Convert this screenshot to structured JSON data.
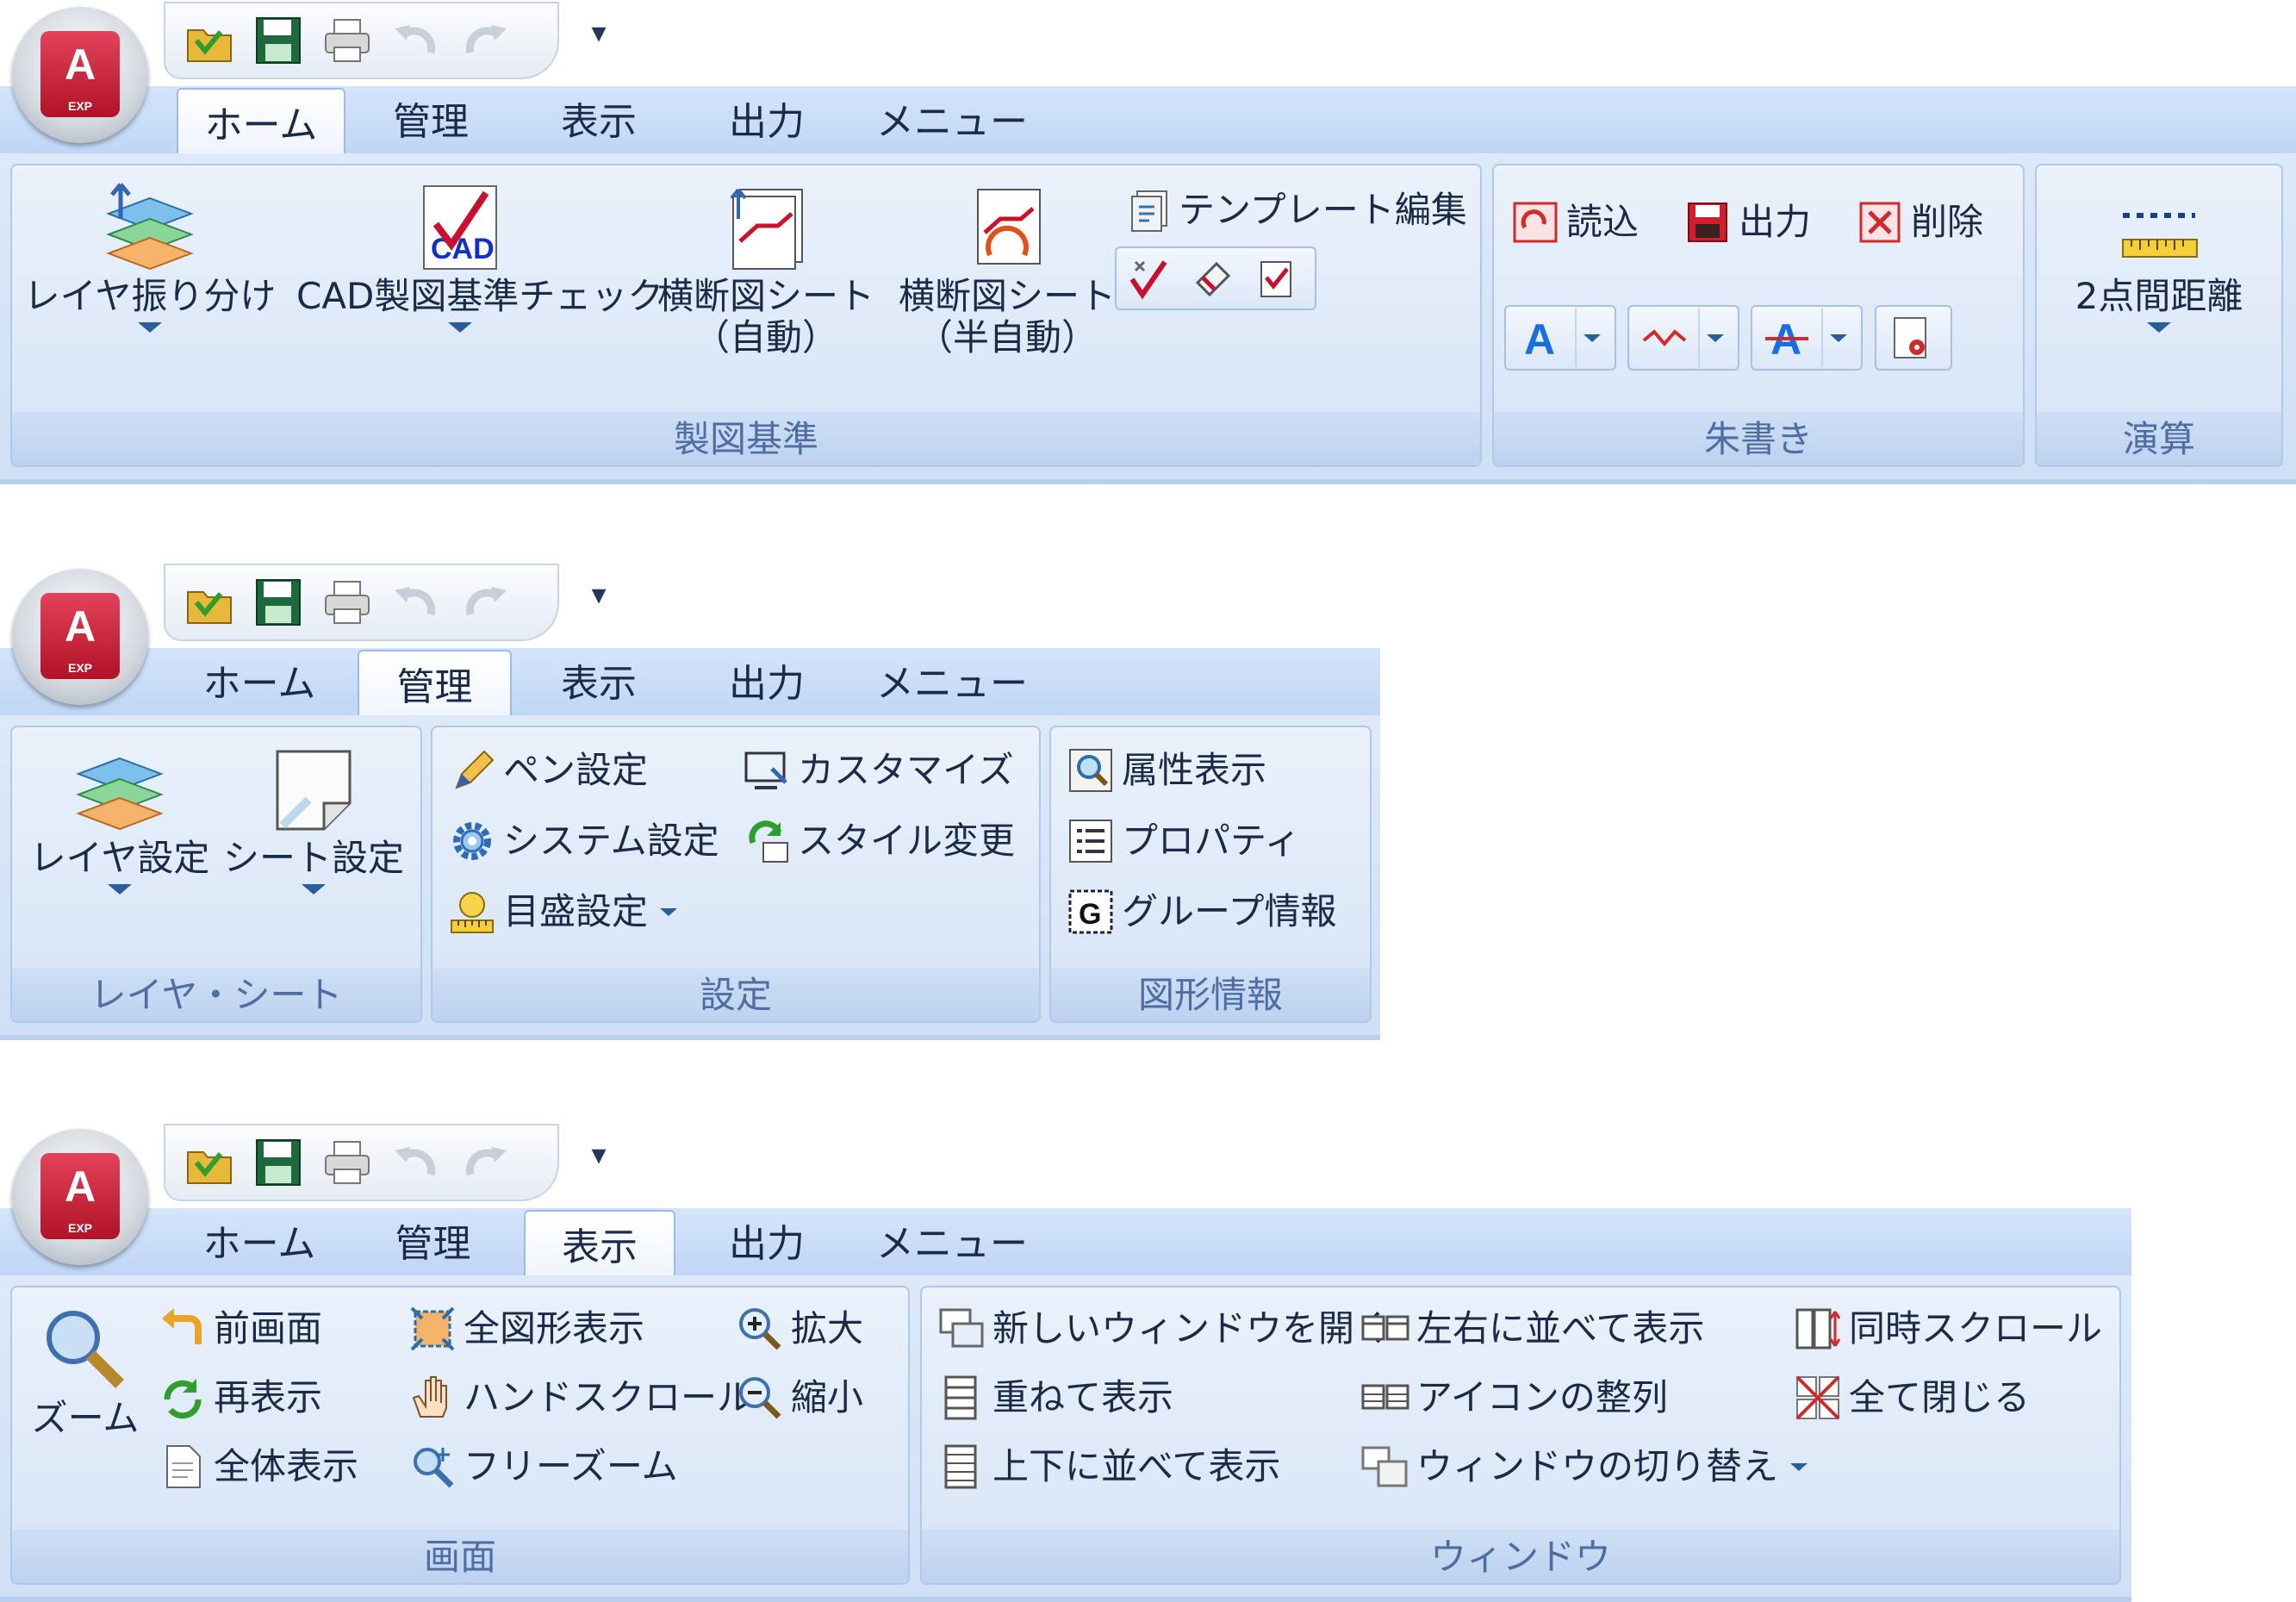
{
  "app_button": {
    "letter": "A",
    "sub": "EXP"
  },
  "qat": {
    "more_symbol": "▾"
  },
  "tabs": {
    "home": "ホーム",
    "manage": "管理",
    "view": "表示",
    "output": "出力",
    "menu": "メニュー"
  },
  "panel1": {
    "drafting_group": {
      "label": "製図基準",
      "layer_sort": "レイヤ振り分け",
      "cad_check": "CAD製図基準チェック",
      "cross_auto_1": "横断図シート",
      "cross_auto_2": "（自動）",
      "cross_semi_1": "横断図シート",
      "cross_semi_2": "（半自動）",
      "template_edit": "テンプレート編集"
    },
    "redline_group": {
      "label": "朱書き",
      "load": "読込",
      "output": "出力",
      "delete": "削除"
    },
    "calc_group": {
      "label": "演算",
      "distance": "2点間距離"
    }
  },
  "panel2": {
    "layer_group": {
      "label": "レイヤ・シート",
      "layer_settings": "レイヤ設定",
      "sheet_settings": "シート設定"
    },
    "settings_group": {
      "label": "設定",
      "pen": "ペン設定",
      "customize": "カスタマイズ",
      "system": "システム設定",
      "style": "スタイル変更",
      "scale": "目盛設定"
    },
    "shape_group": {
      "label": "図形情報",
      "attr": "属性表示",
      "prop": "プロパティ",
      "group": "グループ情報"
    }
  },
  "panel3": {
    "screen_group": {
      "label": "画面",
      "zoom": "ズーム",
      "prev": "前画面",
      "redraw": "再表示",
      "whole": "全体表示",
      "all_shapes": "全図形表示",
      "hand_scroll": "ハンドスクロール",
      "free_zoom": "フリーズーム",
      "zoom_in": "拡大",
      "zoom_out": "縮小"
    },
    "window_group": {
      "label": "ウィンドウ",
      "new_window": "新しいウィンドウを開く",
      "cascade": "重ねて表示",
      "tile_vertical": "上下に並べて表示",
      "tile_horizontal": "左右に並べて表示",
      "arrange_icons": "アイコンの整列",
      "switch_window": "ウィンドウの切り替え",
      "sync_scroll": "同時スクロール",
      "close_all": "全て閉じる"
    }
  }
}
